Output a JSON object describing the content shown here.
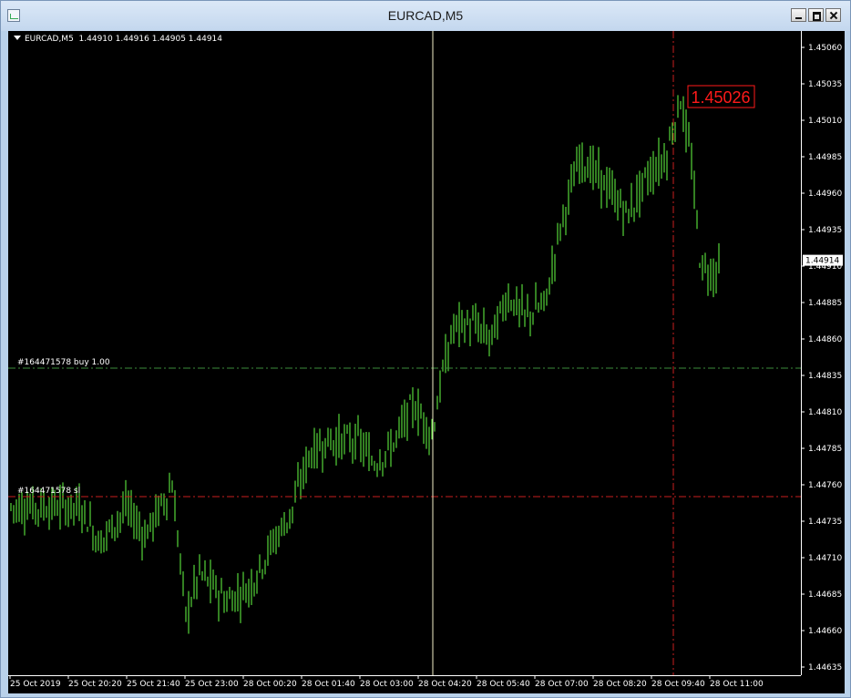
{
  "window": {
    "title": "EURCAD,M5"
  },
  "symbol": {
    "name": "EURCAD,M5",
    "ohlc": "1.44910 1.44916 1.44905 1.44914"
  },
  "price_axis": {
    "labels": [
      "1.45060",
      "1.45035",
      "1.45010",
      "1.44985",
      "1.44960",
      "1.44935",
      "1.44910",
      "1.44885",
      "1.44860",
      "1.44835",
      "1.44810",
      "1.44785",
      "1.44760",
      "1.44735",
      "1.44710",
      "1.44685",
      "1.44660",
      "1.44635"
    ],
    "current_price": "1.44914"
  },
  "time_axis": {
    "labels": [
      "25 Oct 2019",
      "25 Oct 20:20",
      "25 Oct 21:40",
      "25 Oct 23:00",
      "28 Oct 00:20",
      "28 Oct 01:40",
      "28 Oct 03:00",
      "28 Oct 04:20",
      "28 Oct 05:40",
      "28 Oct 07:00",
      "28 Oct 08:20",
      "28 Oct 09:40",
      "28 Oct 11:00"
    ]
  },
  "orders": {
    "buy_label": "#164471578 buy 1.00",
    "sl_label": "#164471578 sl"
  },
  "crosshair": {
    "price_label": "1.45026"
  },
  "colors": {
    "background": "#000000",
    "candle": "#66ff44",
    "buy_line": "#3d8b3d",
    "sl_line": "#c81e1e",
    "crosshair_v": "#f5f0c8",
    "crosshair_h": "#c81e1e",
    "price_tag_text": "#ff1a1a"
  }
}
